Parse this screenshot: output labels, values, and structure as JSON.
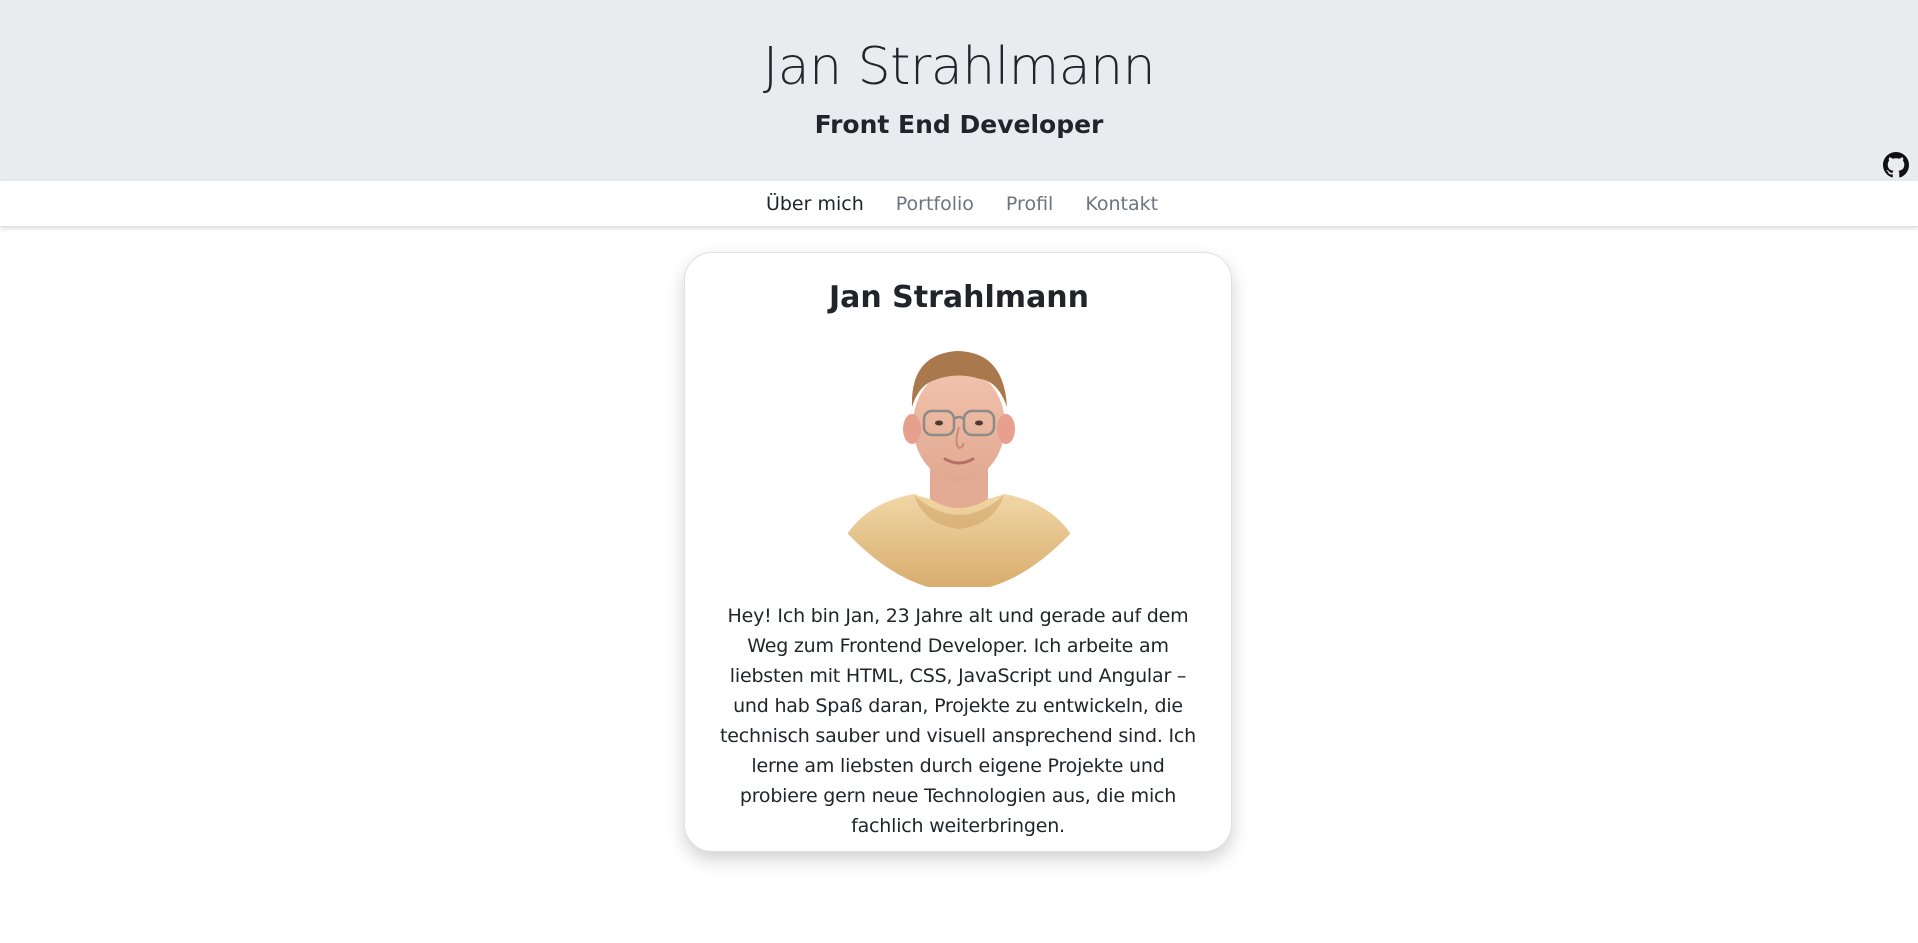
{
  "header": {
    "title": "Jan Strahlmann",
    "subtitle": "Front End Developer",
    "github_icon": "github-icon"
  },
  "nav": {
    "items": [
      {
        "label": "Über mich",
        "active": true
      },
      {
        "label": "Portfolio",
        "active": false
      },
      {
        "label": "Profil",
        "active": false
      },
      {
        "label": "Kontakt",
        "active": false
      }
    ]
  },
  "card": {
    "title": "Jan Strahlmann",
    "text": "Hey! Ich bin Jan, 23 Jahre alt und gerade auf dem Weg zum Frontend Developer. Ich arbeite am liebsten mit HTML, CSS, JavaScript und Angular – und hab Spaß daran, Projekte zu entwickeln, die technisch sauber und visuell ansprechend sind. Ich lerne am liebsten durch eigene Projekte und probiere gern neue Technologien aus, die mich fachlich weiterbringen."
  },
  "colors": {
    "header_bg": "#e9ecef",
    "text": "#212529",
    "nav_muted": "#6c757d"
  }
}
